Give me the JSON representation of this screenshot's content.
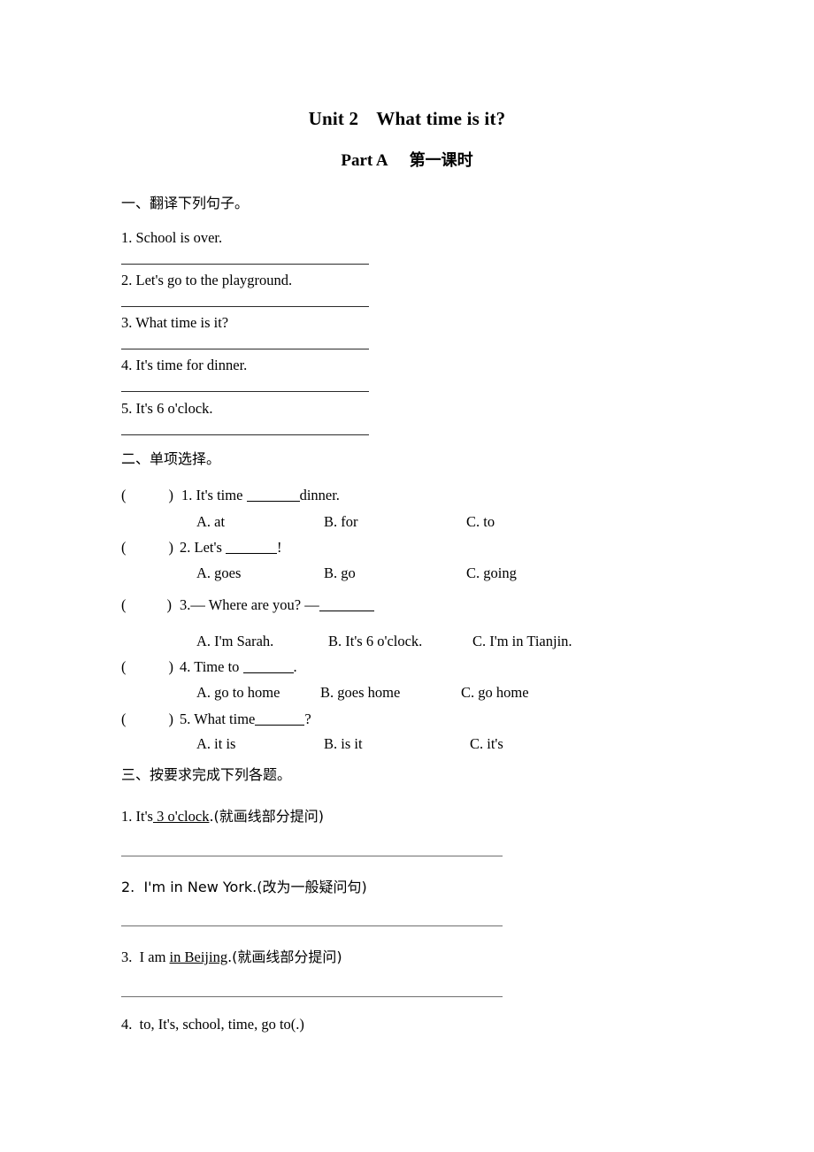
{
  "header": {
    "unit_title": "Unit 2",
    "unit_subject": "What time is it?",
    "part_label": "Part A",
    "period_label": "第一课时"
  },
  "section1": {
    "heading": "一、翻译下列句子。",
    "items": [
      "1. School is over.",
      "2. Let's go to the playground.",
      "3. What time is it?",
      "4. It's time for dinner.",
      "5. It's 6 o'clock."
    ]
  },
  "section2": {
    "heading": "二、单项选择。",
    "paren_open": "(",
    "paren_close": ")",
    "questions": [
      {
        "stem_before": "1. It's time ",
        "stem_after": "dinner.",
        "options": [
          "A. at",
          "B. for",
          "C. to"
        ]
      },
      {
        "stem_before": "2. Let's ",
        "stem_after": "!",
        "options": [
          "A. goes",
          "B. go",
          "C. going"
        ]
      },
      {
        "stem_before": "3.— Where are you? —",
        "stem_after": "",
        "options": [
          "A. I'm Sarah.",
          "B. It's 6 o'clock.",
          "C. I'm in Tianjin."
        ]
      },
      {
        "stem_before": "4. Time to ",
        "stem_after": ".",
        "options": [
          "A. go to home",
          "B. goes home",
          "C. go home"
        ]
      },
      {
        "stem_before": "5. What time",
        "stem_after": "?",
        "options": [
          "A. it is",
          "B. is it",
          "C. it's"
        ]
      }
    ]
  },
  "section3": {
    "heading": "三、按要求完成下列各题。",
    "items": [
      {
        "lead": "1. It's",
        "underlined": " 3 o'clock",
        "tail": ".(就画线部分提问)"
      },
      {
        "lead": "2.  I'm in New York.(改为一般疑问句)",
        "underlined": "",
        "tail": ""
      },
      {
        "lead": "3.  I am ",
        "underlined": "in Beijing",
        "tail": ".(就画线部分提问)"
      },
      {
        "lead": "4.  to, It's, school, time, go to(.)",
        "underlined": "",
        "tail": ""
      }
    ]
  }
}
